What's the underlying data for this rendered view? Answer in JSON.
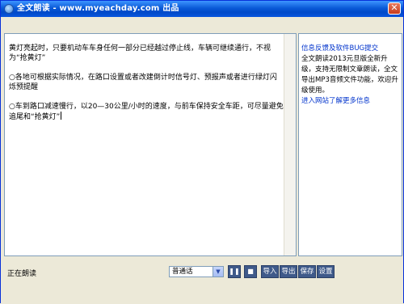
{
  "window": {
    "title": "全文朗读 - www.myeachday.com 出品"
  },
  "editor": {
    "paragraphs": [
      "黄灯亮起时，只要机动车车身任何一部分已经越过停止线，车辆可继续通行，不视为“抢黄灯”",
      "○各地可根据实际情况，在路口设置或者改建倒计时信号灯、预报声或者进行绿灯闪烁预提醒",
      "○车到路口减速慢行，以20—30公里/小时的速度，与前车保持安全车距，可尽量避免追尾和“抢黄灯”"
    ]
  },
  "side": {
    "feedback_link": "信息反馈及软件BUG提交",
    "description": "全文朗读2013元旦版全新升级，支持无限制文章朗读，全文导出MP3音频文件功能，欢迎升级使用。",
    "website_link": "进入网站了解更多信息"
  },
  "status": {
    "text": "正在朗读"
  },
  "controls": {
    "voice_selected": "普通话",
    "import_label": "导入",
    "export_label": "导出",
    "save_label": "保存",
    "settings_label": "设置"
  }
}
